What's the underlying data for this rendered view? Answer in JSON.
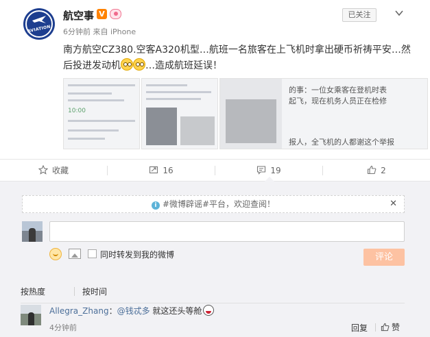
{
  "post": {
    "author_name": "航空事",
    "verified_badge": "V",
    "avatar_text": "AVIATION",
    "meta": "6分钟前 来自 iPhone",
    "follow_label": "已关注",
    "text_main": "南方航空CZ380.空客A320机型…航班一名旅客在上飞机时拿出硬币祈祷平安…然后投进发动机",
    "text_tail": "…造成航班延误！",
    "thumbnails": {
      "t1_num": "10:00",
      "t2_photo_label": "",
      "t3_lines": [
        "的事：一位女乘客在登机时表",
        "起飞，现在机务人员正在检修",
        "报人，全飞机的人都谢这个举报"
      ]
    }
  },
  "actions": {
    "favorite": "收藏",
    "repost_count": "16",
    "comment_count": "19",
    "like_count": "2"
  },
  "comment_box": {
    "tip": "#微博辟谣#平台，欢迎查阅！",
    "input_value": "",
    "repost_check_label": "同时转发到我的微博",
    "submit_label": "评论"
  },
  "sort": {
    "by_hot": "按热度",
    "by_time": "按时间"
  },
  "comments": [
    {
      "user": "Allegra_Zhang",
      "colon": "：",
      "mention": "@钱忒多",
      "text": " 就这还头等舱",
      "time": "4分钟前",
      "reply_label": "回复",
      "like_label": "赞"
    }
  ],
  "colors": {
    "brand_orange": "#ff8200",
    "link_blue": "#4c6f99",
    "submit_disabled": "#fdc2a2"
  }
}
